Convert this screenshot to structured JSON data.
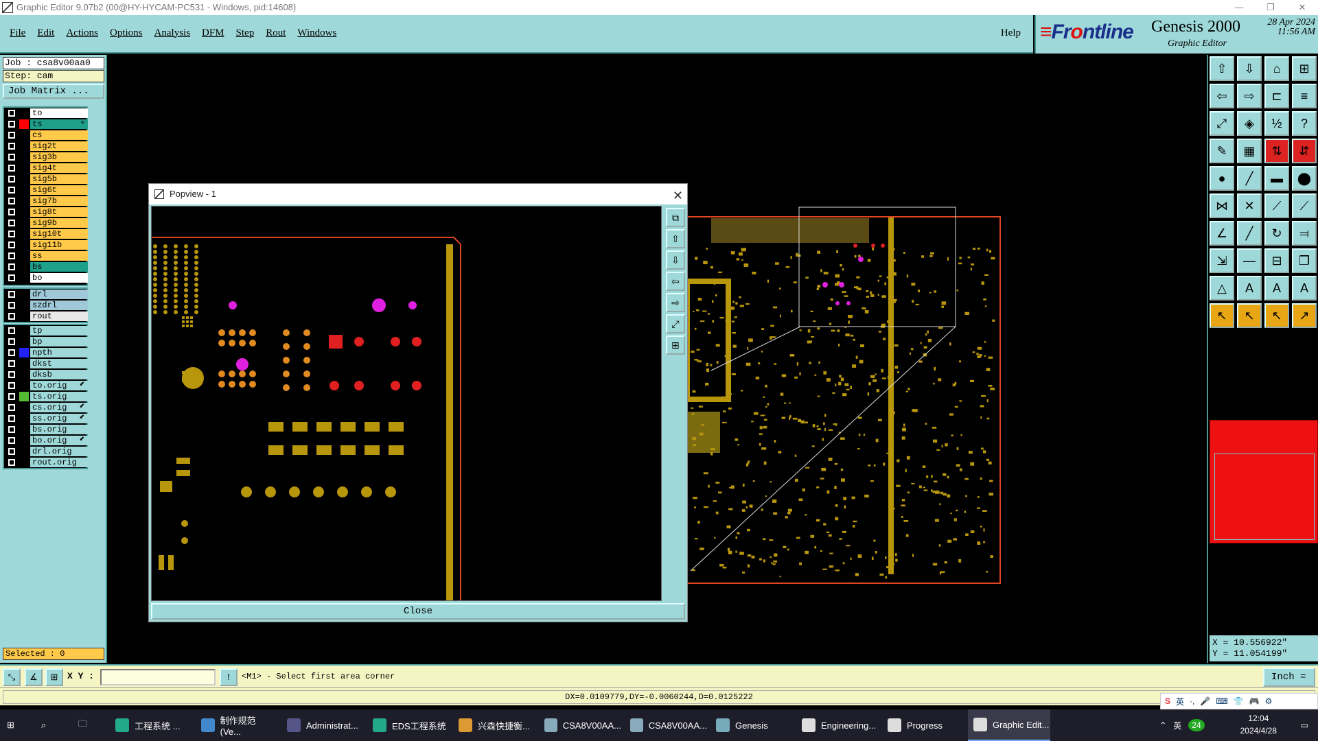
{
  "window": {
    "title": "Graphic Editor 9.07b2 (00@HY-HYCAM-PC531 - Windows, pid:14608)",
    "minimize": "—",
    "restore": "❐",
    "close": "✕"
  },
  "menu": {
    "items": [
      "File",
      "Edit",
      "Actions",
      "Options",
      "Analysis",
      "DFM",
      "Step",
      "Rout",
      "Windows"
    ],
    "help": "Help"
  },
  "brand": {
    "logo_pre": "Fr",
    "logo_o": "o",
    "logo_post": "ntline",
    "product": "Genesis 2000",
    "subtitle": "Graphic Editor",
    "date": "28 Apr 2024",
    "time": "11:56 AM"
  },
  "job": {
    "job_label": "Job  : csa8v00aa0",
    "step_label": "Step: cam",
    "matrix_button": "Job Matrix ..."
  },
  "layers_board": [
    {
      "name": "to",
      "bg": "#ffffff",
      "sw": "#000000"
    },
    {
      "name": "ts",
      "bg": "#1fa08a",
      "sw": "#ff0000",
      "mark": "≡"
    },
    {
      "name": "cs",
      "bg": "#ffc94a",
      "sw": "#000000"
    },
    {
      "name": "sig2t",
      "bg": "#ffc94a",
      "sw": "#000000"
    },
    {
      "name": "sig3b",
      "bg": "#ffc94a",
      "sw": "#000000"
    },
    {
      "name": "sig4t",
      "bg": "#ffc94a",
      "sw": "#000000"
    },
    {
      "name": "sig5b",
      "bg": "#ffc94a",
      "sw": "#000000"
    },
    {
      "name": "sig6t",
      "bg": "#ffc94a",
      "sw": "#000000"
    },
    {
      "name": "sig7b",
      "bg": "#ffc94a",
      "sw": "#000000"
    },
    {
      "name": "sig8t",
      "bg": "#ffc94a",
      "sw": "#000000"
    },
    {
      "name": "sig9b",
      "bg": "#ffc94a",
      "sw": "#000000"
    },
    {
      "name": "sig10t",
      "bg": "#ffc94a",
      "sw": "#000000"
    },
    {
      "name": "sig11b",
      "bg": "#ffc94a",
      "sw": "#000000"
    },
    {
      "name": "ss",
      "bg": "#ffc94a",
      "sw": "#000000"
    },
    {
      "name": "bs",
      "bg": "#1fa08a",
      "sw": "#000000"
    },
    {
      "name": "bo",
      "bg": "#ffffff",
      "sw": "#000000"
    }
  ],
  "layers_drill": [
    {
      "name": "drl",
      "bg": "#9fc8d8",
      "sw": "#000000"
    },
    {
      "name": "szdrl",
      "bg": "#9fc8d8",
      "sw": "#000000"
    },
    {
      "name": "rout",
      "bg": "#e8e8e8",
      "sw": "#000000"
    }
  ],
  "layers_misc": [
    {
      "name": "tp",
      "bg": "#9fd8d8",
      "sw": "#000000"
    },
    {
      "name": "bp",
      "bg": "#9fd8d8",
      "sw": "#000000"
    },
    {
      "name": "npth",
      "bg": "#9fd8d8",
      "sw": "#2222ff"
    },
    {
      "name": "dkst",
      "bg": "#9fd8d8",
      "sw": "#000000"
    },
    {
      "name": "dksb",
      "bg": "#9fd8d8",
      "sw": "#000000"
    },
    {
      "name": "to.orig",
      "bg": "#9fd8d8",
      "sw": "#000000",
      "mark": "⬋"
    },
    {
      "name": "ts.orig",
      "bg": "#9fd8d8",
      "sw": "#55bb33"
    },
    {
      "name": "cs.orig",
      "bg": "#9fd8d8",
      "sw": "#000000",
      "mark": "⬋"
    },
    {
      "name": "ss.orig",
      "bg": "#9fd8d8",
      "sw": "#000000",
      "mark": "⬋"
    },
    {
      "name": "bs.orig",
      "bg": "#9fd8d8",
      "sw": "#000000"
    },
    {
      "name": "bo.orig",
      "bg": "#9fd8d8",
      "sw": "#000000",
      "mark": "⬋"
    },
    {
      "name": "drl.orig",
      "bg": "#9fd8d8",
      "sw": "#000000"
    },
    {
      "name": "rout.orig",
      "bg": "#9fd8d8",
      "sw": "#000000"
    }
  ],
  "selected": "Selected : 0",
  "popview": {
    "title": "Popview - 1",
    "close_label": "Close",
    "close_x": "✕"
  },
  "coords": {
    "x": "X = 10.556922\"",
    "y": "Y = 11.054199\""
  },
  "command": {
    "xy_label": "X Y :",
    "xy_value": "",
    "prompt": "<M1> - Select first area corner",
    "units": "Inch ="
  },
  "status": {
    "text": "DX=0.0109779,DY=-0.0060244,D=0.0125222"
  },
  "ime": [
    "英",
    "·,",
    "🎤",
    "⌨",
    "👕",
    "🎮",
    "⚙"
  ],
  "taskbar": {
    "apps": [
      {
        "label": "工程系统  ...",
        "color": "#2a8"
      },
      {
        "label": "制作规范 (Ve...",
        "color": "#48c"
      },
      {
        "label": "Administrat...",
        "color": "#558"
      },
      {
        "label": "EDS工程系统",
        "color": "#2a8"
      },
      {
        "label": "兴森快捷衡...",
        "color": "#d93"
      },
      {
        "label": "CSA8V00AA...",
        "color": "#8ab"
      },
      {
        "label": "CSA8V00AA...",
        "color": "#8ab"
      },
      {
        "label": "Genesis",
        "color": "#7ab"
      },
      {
        "label": "Engineering...",
        "color": "#ddd"
      },
      {
        "label": "Progress",
        "color": "#ddd"
      },
      {
        "label": "Graphic Edit...",
        "color": "#ddd"
      }
    ],
    "clock_time": "12:04",
    "clock_date": "2024/4/28",
    "tray_lang": "英",
    "tray_badge": "24"
  }
}
